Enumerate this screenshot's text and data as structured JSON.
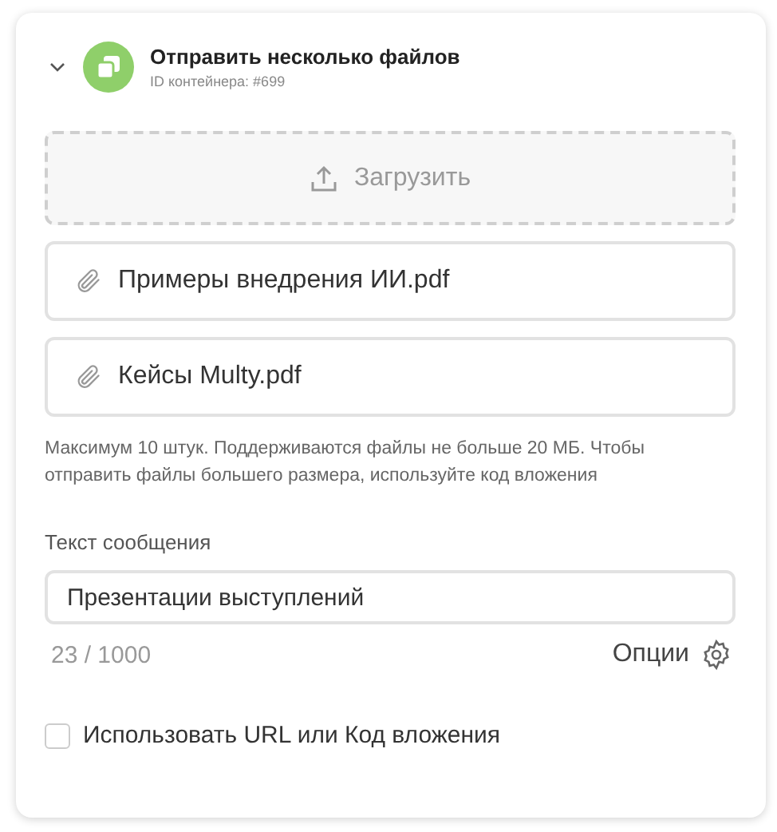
{
  "header": {
    "expanded": true,
    "title": "Отправить несколько файлов",
    "subtitle": "ID контейнера: #699"
  },
  "upload": {
    "label": "Загрузить"
  },
  "files": [
    {
      "name": "Примеры внедрения ИИ.pdf"
    },
    {
      "name": "Кейсы Multy.pdf"
    }
  ],
  "hint": "Максимум 10 штук. Поддерживаются файлы не больше 20 МБ. Чтобы отправить файлы большего размера, используйте код вложения",
  "message": {
    "label": "Текст сообщения",
    "value": "Презентации выступлений",
    "counter": "23 / 1000",
    "options": "Опции"
  },
  "use_url": {
    "label": "Использовать URL или Код вложения",
    "checked": false
  }
}
